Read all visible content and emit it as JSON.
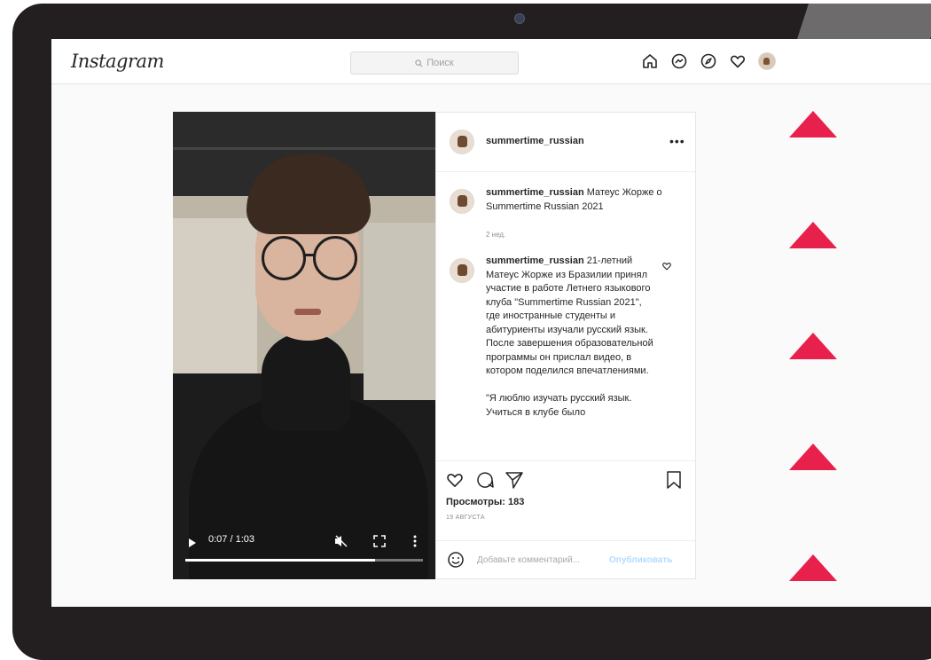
{
  "app": {
    "logo": "Instagram"
  },
  "search": {
    "placeholder": "Поиск"
  },
  "nav": {
    "icons": [
      "home-icon",
      "messenger-icon",
      "explore-icon",
      "heart-icon",
      "profile-avatar"
    ]
  },
  "video": {
    "time": "0:07 / 1:03",
    "progress_fraction": 0.8
  },
  "post": {
    "username": "summertime_russian",
    "more": "•••",
    "caption1_text": "Матеус Жорже о Summertime Russian 2021",
    "caption1_age": "2 нед.",
    "caption2_text": "21-летний Матеус Жорже из Бразилии принял участие в работе Летнего языкового клуба \"Summertime Russian 2021\", где иностранные студенты и абитуриенты изучали русский язык. После завершения образовательной программы он прислал видео, в котором поделился впечатлениями.",
    "caption2_quote": "\"Я люблю изучать русский язык. Учиться в клубе было",
    "views": "Просмотры: 183",
    "date": "19 АВГУСТА",
    "comment_placeholder": "Добавьте комментарий...",
    "post_button": "Опубликовать"
  },
  "colors": {
    "accent": "#e8204c",
    "link": "#b3dbff",
    "text": "#262626"
  }
}
